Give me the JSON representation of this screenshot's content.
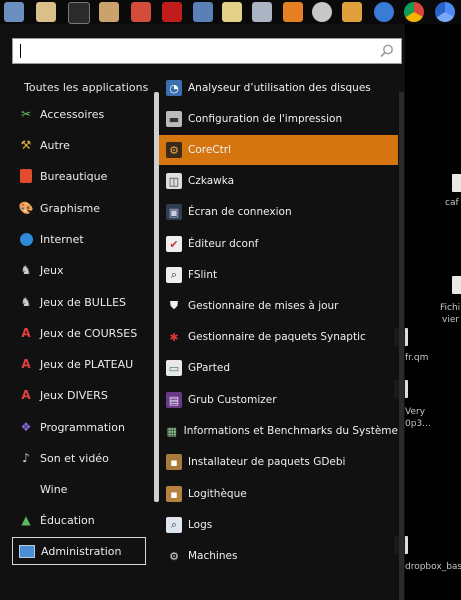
{
  "taskbar": {
    "icons": [
      "terminal-icon",
      "files-icon",
      "media-icon",
      "filezilla-icon",
      "network-icon",
      "folder-icon",
      "camera-icon",
      "archive-icon",
      "settings-icon",
      "bottle-icon",
      "linux-icon",
      "chrome-icon",
      "chromium-icon"
    ]
  },
  "desktop": {
    "labels": [
      "caf d",
      "Fichi",
      "vier fi",
      "fr.qm",
      "Very",
      "0p3...",
      "dropbox_base"
    ]
  },
  "search": {
    "value": "",
    "placeholder": ""
  },
  "categories_header": "Toutes les applications",
  "categories": [
    {
      "label": "Accessoires",
      "icon": "accessories-icon"
    },
    {
      "label": "Autre",
      "icon": "other-icon"
    },
    {
      "label": "Bureautique",
      "icon": "office-icon"
    },
    {
      "label": "Graphisme",
      "icon": "graphics-icon"
    },
    {
      "label": "Internet",
      "icon": "internet-icon"
    },
    {
      "label": "Jeux",
      "icon": "games-icon"
    },
    {
      "label": "Jeux de BULLES",
      "icon": "bubble-games-icon"
    },
    {
      "label": "Jeux de COURSES",
      "icon": "racing-games-icon"
    },
    {
      "label": "Jeux de PLATEAU",
      "icon": "board-games-icon"
    },
    {
      "label": "Jeux DIVERS",
      "icon": "misc-games-icon"
    },
    {
      "label": "Programmation",
      "icon": "programming-icon"
    },
    {
      "label": "Son et vidéo",
      "icon": "sound-video-icon"
    },
    {
      "label": "Wine",
      "icon": ""
    },
    {
      "label": "Éducation",
      "icon": "education-icon"
    },
    {
      "label": "Administration",
      "icon": "administration-icon"
    }
  ],
  "apps": [
    {
      "label": "Analyseur d’utilisation des disques",
      "icon": "disk-usage-icon"
    },
    {
      "label": "Configuration de l'impression",
      "icon": "printer-icon"
    },
    {
      "label": "CoreCtrl",
      "icon": "corectrl-icon"
    },
    {
      "label": "Czkawka",
      "icon": "czkawka-icon"
    },
    {
      "label": "Écran de connexion",
      "icon": "login-screen-icon"
    },
    {
      "label": "Éditeur dconf",
      "icon": "dconf-icon"
    },
    {
      "label": "FSlint",
      "icon": "fslint-icon"
    },
    {
      "label": "Gestionnaire de mises à jour",
      "icon": "update-manager-icon"
    },
    {
      "label": "Gestionnaire de paquets Synaptic",
      "icon": "synaptic-icon"
    },
    {
      "label": "GParted",
      "icon": "gparted-icon"
    },
    {
      "label": "Grub Customizer",
      "icon": "grub-icon"
    },
    {
      "label": "Informations et Benchmarks du Système",
      "icon": "hardinfo-icon"
    },
    {
      "label": "Installateur de paquets GDebi",
      "icon": "gdebi-icon"
    },
    {
      "label": "Logithèque",
      "icon": "software-center-icon"
    },
    {
      "label": "Logs",
      "icon": "logs-icon"
    },
    {
      "label": "Machines",
      "icon": "machines-icon"
    }
  ],
  "active_app": "CoreCtrl",
  "selected_category": "Administration",
  "colors": {
    "highlight": "#d4750f",
    "menu_bg": "#121212",
    "text": "#ececec"
  }
}
